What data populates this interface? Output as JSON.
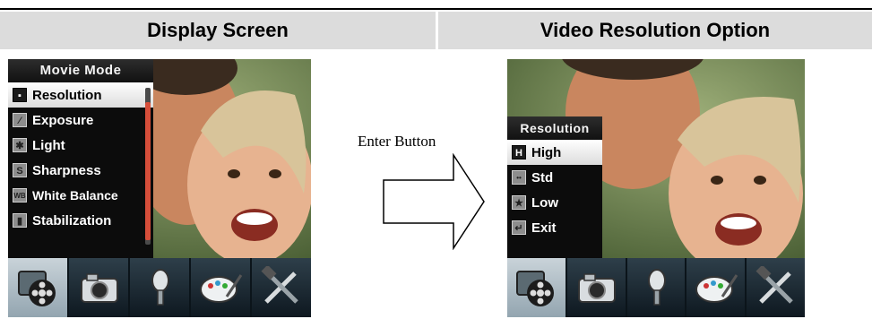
{
  "headers": {
    "left": "Display Screen",
    "right": "Video Resolution Option"
  },
  "left_screen": {
    "menu_title": "Movie Mode",
    "items": [
      {
        "icon": "resolution-icon",
        "glyph": "▪",
        "label": "Resolution",
        "selected": true
      },
      {
        "icon": "exposure-icon",
        "glyph": "⁄",
        "label": "Exposure",
        "selected": false
      },
      {
        "icon": "light-icon",
        "glyph": "✱",
        "label": "Light",
        "selected": false
      },
      {
        "icon": "sharpness-icon",
        "glyph": "S",
        "label": "Sharpness",
        "selected": false
      },
      {
        "icon": "white-balance-icon",
        "glyph": "WB",
        "label": "White Balance",
        "selected": false
      },
      {
        "icon": "stabilization-icon",
        "glyph": "▮",
        "label": "Stabilization",
        "selected": false
      }
    ]
  },
  "arrow": {
    "label": "Enter Button"
  },
  "right_screen": {
    "menu_title": "Resolution",
    "items": [
      {
        "icon": "high-res-icon",
        "glyph": "H",
        "label": "High",
        "selected": true
      },
      {
        "icon": "std-res-icon",
        "glyph": "••",
        "label": "Std",
        "selected": false
      },
      {
        "icon": "low-res-icon",
        "glyph": "★",
        "label": "Low",
        "selected": false
      },
      {
        "icon": "exit-icon",
        "glyph": "↵",
        "label": "Exit",
        "selected": false
      }
    ]
  },
  "toolbar": [
    {
      "name": "movie-mode-icon",
      "active": true
    },
    {
      "name": "camera-icon",
      "active": false
    },
    {
      "name": "microphone-icon",
      "active": false
    },
    {
      "name": "palette-icon",
      "active": false
    },
    {
      "name": "tools-icon",
      "active": false
    }
  ]
}
